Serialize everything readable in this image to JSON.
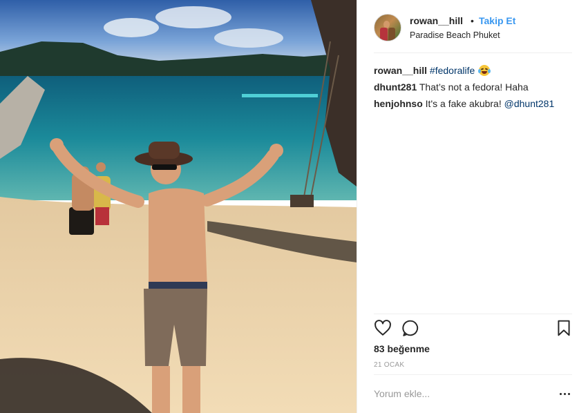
{
  "post": {
    "author": {
      "username": "rowan__hill",
      "separator": "•",
      "follow_label": "Takip Et",
      "location": "Paradise Beach Phuket"
    },
    "comments": [
      {
        "username": "rowan__hill",
        "text": "",
        "hashtag": "#fedoralife",
        "emoji": "face-with-tears-of-joy"
      },
      {
        "username": "dhunt281",
        "text": "That’s not a fedora! Haha"
      },
      {
        "username": "henjohnso",
        "text": "It's a fake akubra!",
        "mention": "@dhunt281"
      }
    ],
    "likes_label": "83 beğenme",
    "date_label": "21 OCAK",
    "add_comment_placeholder": "Yorum ekle...",
    "icons": {
      "like": "heart-outline-icon",
      "comment": "speech-bubble-icon",
      "save": "bookmark-outline-icon",
      "more": "ellipsis-icon"
    },
    "colors": {
      "accent_link": "#3897f0",
      "text": "#262626",
      "muted": "#999999",
      "mention": "#003569"
    }
  }
}
